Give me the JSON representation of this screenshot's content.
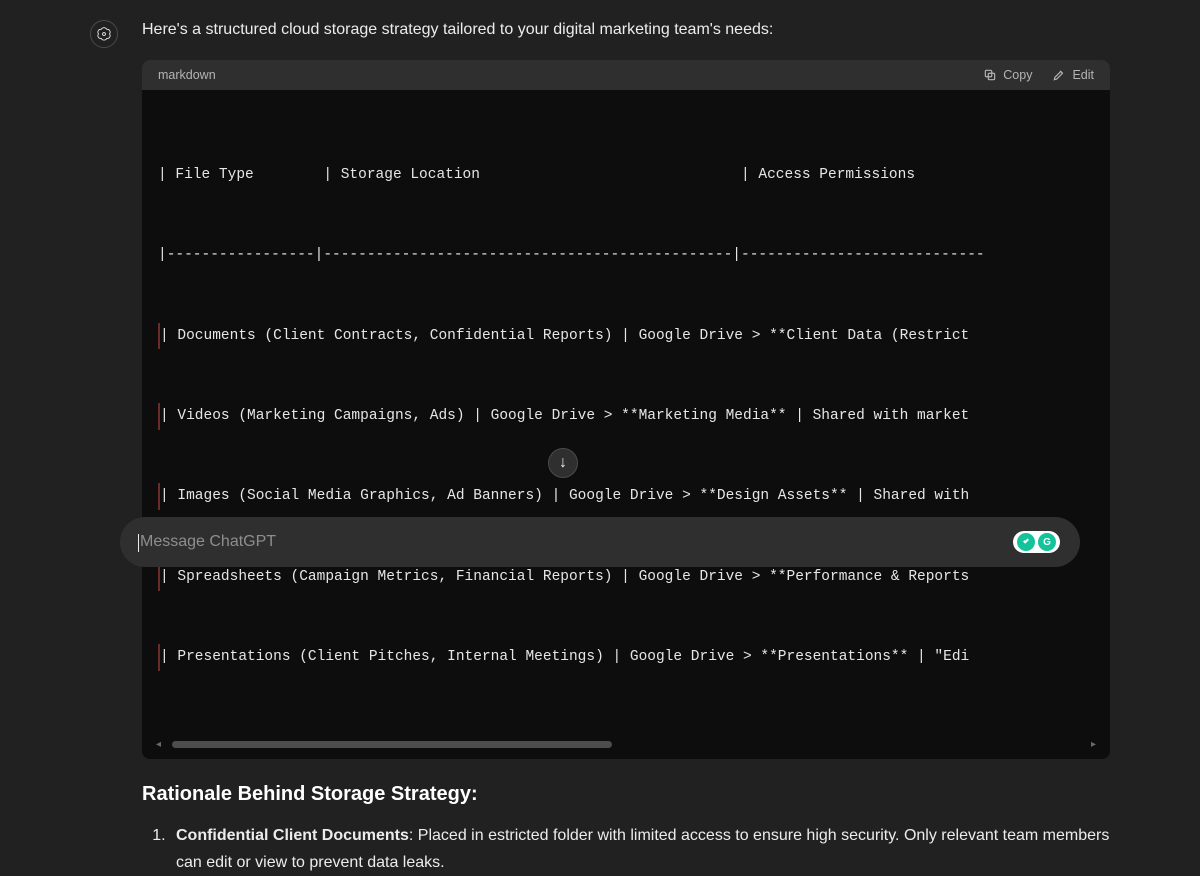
{
  "intro": "Here's a structured cloud storage strategy tailored to your digital marketing team's needs:",
  "code": {
    "lang": "markdown",
    "copy_label": "Copy",
    "edit_label": "Edit",
    "lines": [
      "| File Type        | Storage Location                              | Access Permissions         ",
      "|-----------------|-----------------------------------------------|----------------------------",
      "| Documents (Client Contracts, Confidential Reports) | Google Drive > **Client Data (Restrict",
      "| Videos (Marketing Campaigns, Ads) | Google Drive > **Marketing Media** | Shared with market",
      "| Images (Social Media Graphics, Ad Banners) | Google Drive > **Design Assets** | Shared with ",
      "| Spreadsheets (Campaign Metrics, Financial Reports) | Google Drive > **Performance & Reports",
      "| Presentations (Client Pitches, Internal Meetings) | Google Drive > **Presentations** | \"Edi"
    ]
  },
  "rationale": {
    "heading": "Rationale Behind Storage Strategy:",
    "items": [
      {
        "strong": "Confidential Client Documents",
        "text": ": Placed in     estricted folder with limited access to ensure high security. Only relevant team members can edit or view to prevent data leaks."
      }
    ]
  },
  "input": {
    "placeholder": "Message ChatGPT"
  }
}
